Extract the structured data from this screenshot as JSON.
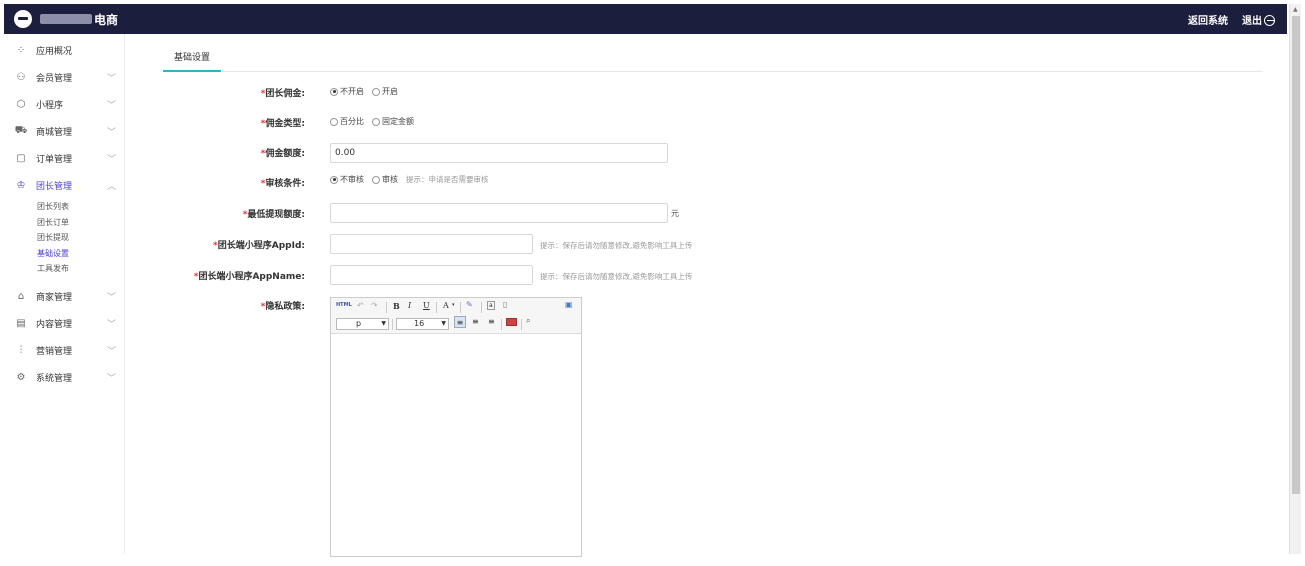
{
  "header": {
    "brand": "电商",
    "return_label": "返回系统",
    "logout_label": "退出"
  },
  "sidebar": {
    "items": [
      {
        "label": "应用概况",
        "icon": "grid-icon"
      },
      {
        "label": "会员管理",
        "icon": "users-icon"
      },
      {
        "label": "小程序",
        "icon": "cube-icon"
      },
      {
        "label": "商城管理",
        "icon": "cart-icon"
      },
      {
        "label": "订单管理",
        "icon": "clipboard-icon"
      },
      {
        "label": "团长管理",
        "icon": "crown-icon"
      },
      {
        "label": "商家管理",
        "icon": "shop-icon"
      },
      {
        "label": "内容管理",
        "icon": "document-icon"
      },
      {
        "label": "营销管理",
        "icon": "chart-icon"
      },
      {
        "label": "系统管理",
        "icon": "gear-icon"
      }
    ],
    "sub_items": [
      "团长列表",
      "团长订单",
      "团长提现",
      "基础设置",
      "工具发布"
    ]
  },
  "tabs": {
    "active": "基础设置"
  },
  "form": {
    "commission": {
      "label": "团长佣金:",
      "options": [
        "不开启",
        "开启"
      ],
      "selected": 0
    },
    "commission_type": {
      "label": "佣金类型:",
      "options": [
        "百分比",
        "固定金额"
      ],
      "selected": -1
    },
    "commission_amount": {
      "label": "佣金额度:",
      "value": "0.00"
    },
    "review": {
      "label": "审核条件:",
      "options": [
        "不审核",
        "审核"
      ],
      "selected": 0,
      "hint": "提示：申请是否需要审核"
    },
    "min_withdraw": {
      "label": "最低提现额度:",
      "value": "",
      "unit": "元"
    },
    "appid": {
      "label": "团长端小程序AppId:",
      "value": "",
      "hint": "提示：保存后请勿随意修改,避免影响工具上传"
    },
    "appname": {
      "label": "团长端小程序AppName:",
      "value": "",
      "hint": "提示：保存后请勿随意修改,避免影响工具上传"
    },
    "privacy": {
      "label": "隐私政策:"
    }
  },
  "editor": {
    "html_label": "HTML",
    "paragraph": "p",
    "font_size": "16",
    "bold": "B",
    "italic": "I",
    "underline": "U",
    "font_color": "A"
  }
}
